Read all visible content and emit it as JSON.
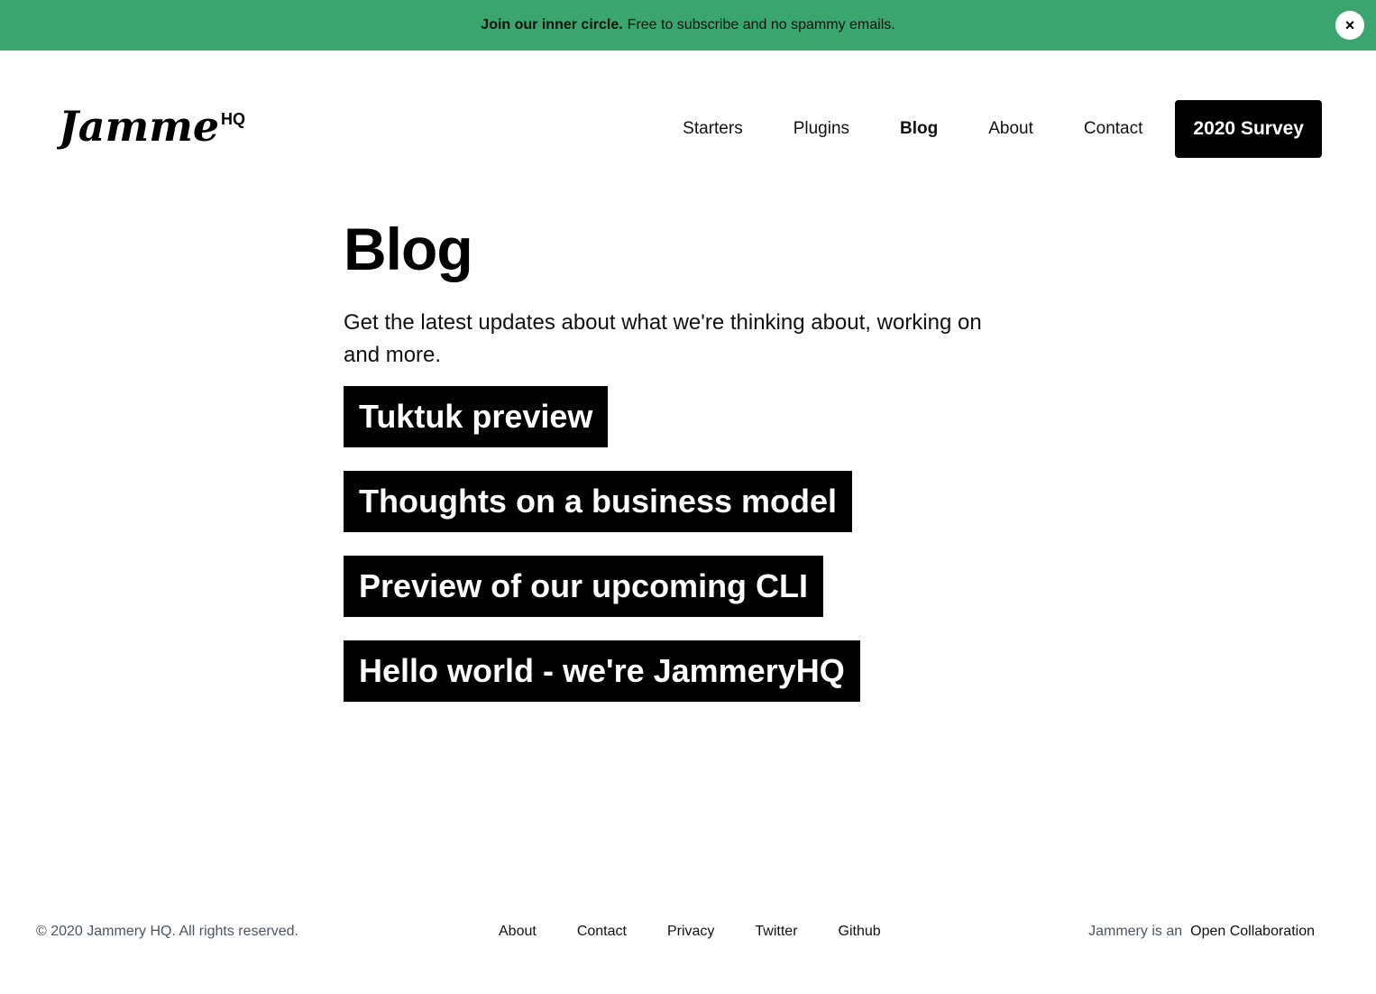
{
  "banner": {
    "bold_text": "Join our inner circle.",
    "text": "Free to subscribe and no spammy emails.",
    "close_label": "×",
    "bg_color": "#3aa56c"
  },
  "header": {
    "logo_text": "Jammery",
    "logo_suffix": "HQ",
    "nav": [
      {
        "label": "Starters"
      },
      {
        "label": "Plugins"
      },
      {
        "label": "Blog"
      },
      {
        "label": "About"
      },
      {
        "label": "Contact"
      }
    ],
    "cta_label": "2020 Survey"
  },
  "main": {
    "title": "Blog",
    "intro": "Get the latest updates about what we're thinking about, working on and more.",
    "posts": [
      {
        "title": "Tuktuk preview"
      },
      {
        "title": "Thoughts on a business model"
      },
      {
        "title": "Preview of our upcoming CLI"
      },
      {
        "title": "Hello world - we're JammeryHQ"
      }
    ]
  },
  "footer": {
    "copyright": "© 2020 Jammery HQ. All rights reserved.",
    "links": [
      {
        "label": "About"
      },
      {
        "label": "Contact"
      },
      {
        "label": "Privacy"
      },
      {
        "label": "Twitter"
      },
      {
        "label": "Github"
      }
    ],
    "collab_prefix": "Jammery is an",
    "collab_link": "Open Collaboration"
  }
}
